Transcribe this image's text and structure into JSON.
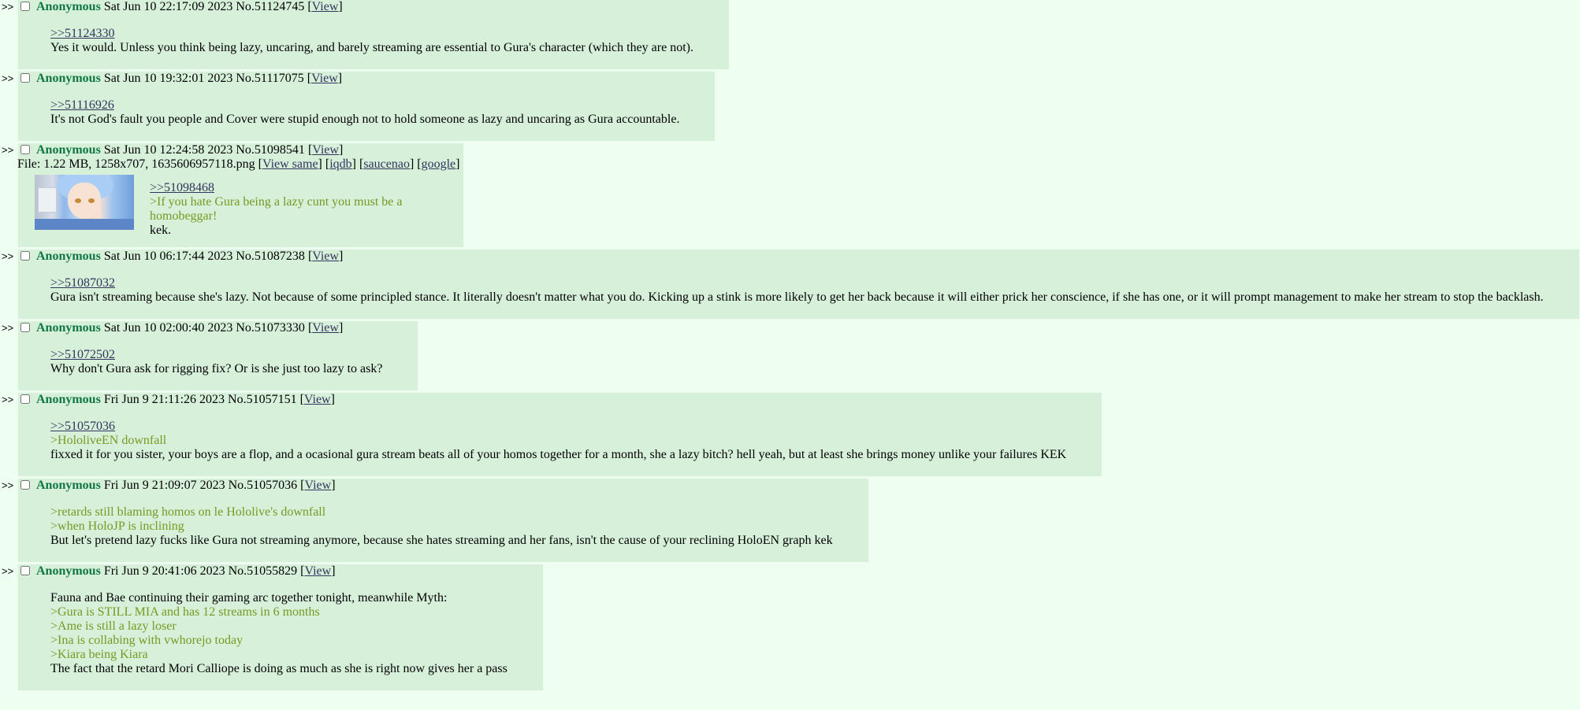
{
  "arrows": ">>",
  "view_label": "View",
  "posts": [
    {
      "name": "Anonymous",
      "date": "Sat Jun 10 22:17:09 2023",
      "no": "No.51124745",
      "quote": ">>51124330",
      "lines": [
        "Yes it would. Unless you think being lazy, uncaring, and barely streaming are essential to Gura's character (which they are not)."
      ]
    },
    {
      "name": "Anonymous",
      "date": "Sat Jun 10 19:32:01 2023",
      "no": "No.51117075",
      "quote": ">>51116926",
      "lines": [
        "It's not God's fault you people and Cover were stupid enough not to hold someone as lazy and uncaring as Gura accountable."
      ]
    },
    {
      "name": "Anonymous",
      "date": "Sat Jun 10 12:24:58 2023",
      "no": "No.51098541",
      "file": {
        "prefix": "File: 1.22 MB, 1258x707, 1635606957118.png",
        "view_same": "View same",
        "iqdb": "iqdb",
        "saucenao": "saucenao",
        "google": "google"
      },
      "quote": ">>51098468",
      "green1": ">If you hate Gura being a lazy cunt you must be a",
      "green2": "homobeggar!",
      "line": "kek."
    },
    {
      "name": "Anonymous",
      "date": "Sat Jun 10 06:17:44 2023",
      "no": "No.51087238",
      "quote": ">>51087032",
      "lines": [
        "Gura isn't streaming because she's lazy. Not because of some principled stance. It literally doesn't matter what you do. Kicking up a stink is more likely to get her back because it will either prick her conscience, if she has one, or it will prompt management to make her stream to stop the backlash."
      ]
    },
    {
      "name": "Anonymous",
      "date": "Sat Jun 10 02:00:40 2023",
      "no": "No.51073330",
      "quote": ">>51072502",
      "lines": [
        "Why don't Gura ask for rigging fix? Or is she just too lazy to ask?"
      ]
    },
    {
      "name": "Anonymous",
      "date": "Fri Jun 9 21:11:26 2023",
      "no": "No.51057151",
      "quote": ">>51057036",
      "green": [
        ">HololiveEN downfall"
      ],
      "lines": [
        "fixxed it for you sister, your boys are a flop, and a ocasional gura stream beats all of your homos together for a month, she a lazy bitch? hell yeah, but at least she brings money unlike your failures KEK"
      ]
    },
    {
      "name": "Anonymous",
      "date": "Fri Jun 9 21:09:07 2023",
      "no": "No.51057036",
      "green": [
        ">retards still blaming homos on le Hololive's downfall",
        ">when HoloJP is inclining"
      ],
      "lines": [
        "But let's pretend lazy fucks like Gura not streaming anymore, because she hates streaming and her fans, isn't the cause of your reclining HoloEN graph kek"
      ]
    },
    {
      "name": "Anonymous",
      "date": "Fri Jun 9 20:41:06 2023",
      "no": "No.51055829",
      "intro": "Fauna and Bae continuing their gaming arc together tonight, meanwhile Myth:",
      "green": [
        ">Gura is STILL MIA and has 12 streams in 6 months",
        ">Ame is still a lazy loser",
        ">Ina is collabing with vwhorejo today",
        ">Kiara being Kiara"
      ],
      "lines": [
        "The fact that the retard Mori Calliope is doing as much as she is right now gives her a pass"
      ]
    }
  ]
}
